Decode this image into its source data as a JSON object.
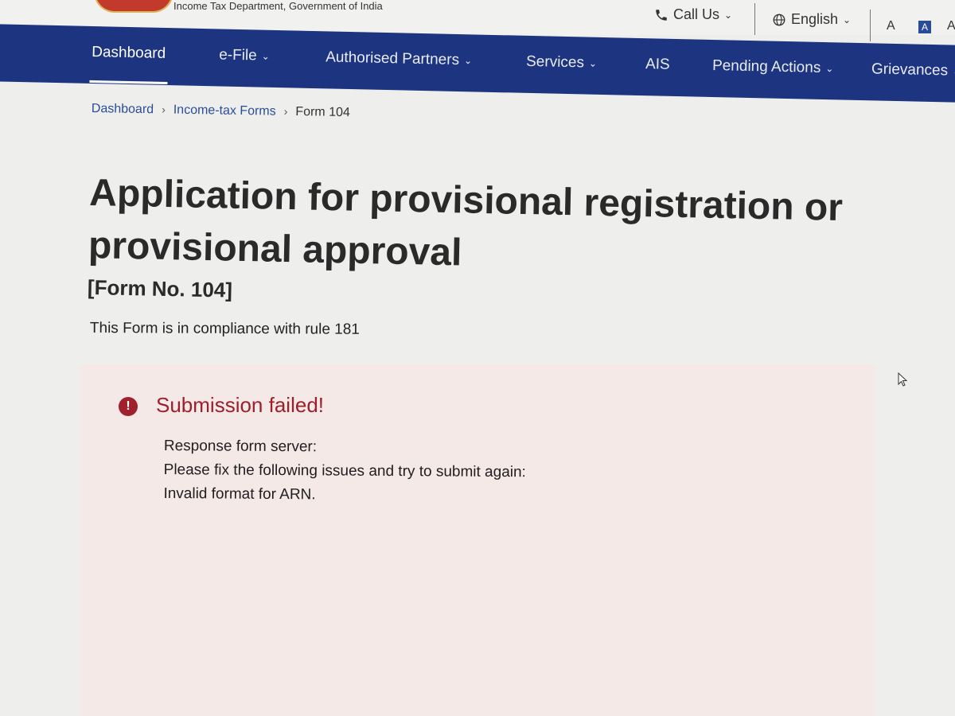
{
  "header": {
    "department": "Income Tax Department, Government of India",
    "call_us": "Call Us",
    "language": "English",
    "font_decrease": "A",
    "font_normal": "A",
    "font_increase": "A"
  },
  "nav": {
    "items": [
      {
        "label": "Dashboard",
        "active": true
      },
      {
        "label": "e-File",
        "dropdown": true
      },
      {
        "label": "Authorised Partners",
        "dropdown": true
      },
      {
        "label": "Services",
        "dropdown": true
      },
      {
        "label": "AIS"
      },
      {
        "label": "Pending Actions",
        "dropdown": true
      },
      {
        "label": "Grievances",
        "dropdown": true
      }
    ]
  },
  "breadcrumb": {
    "items": [
      "Dashboard",
      "Income-tax Forms",
      "Form 104"
    ]
  },
  "page": {
    "title": "Application for provisional registration or provisional approval",
    "form_no": "[Form No. 104]",
    "compliance": "This Form is in compliance with rule 181"
  },
  "error": {
    "title": "Submission failed!",
    "lines": [
      "Response form server:",
      "Please fix the following issues and try to submit again:",
      "Invalid format for ARN."
    ]
  },
  "colors": {
    "nav_bg": "#1d3580",
    "error_red": "#9c1f2b",
    "error_bg": "#f4e9e7",
    "link_blue": "#2a4c98"
  }
}
